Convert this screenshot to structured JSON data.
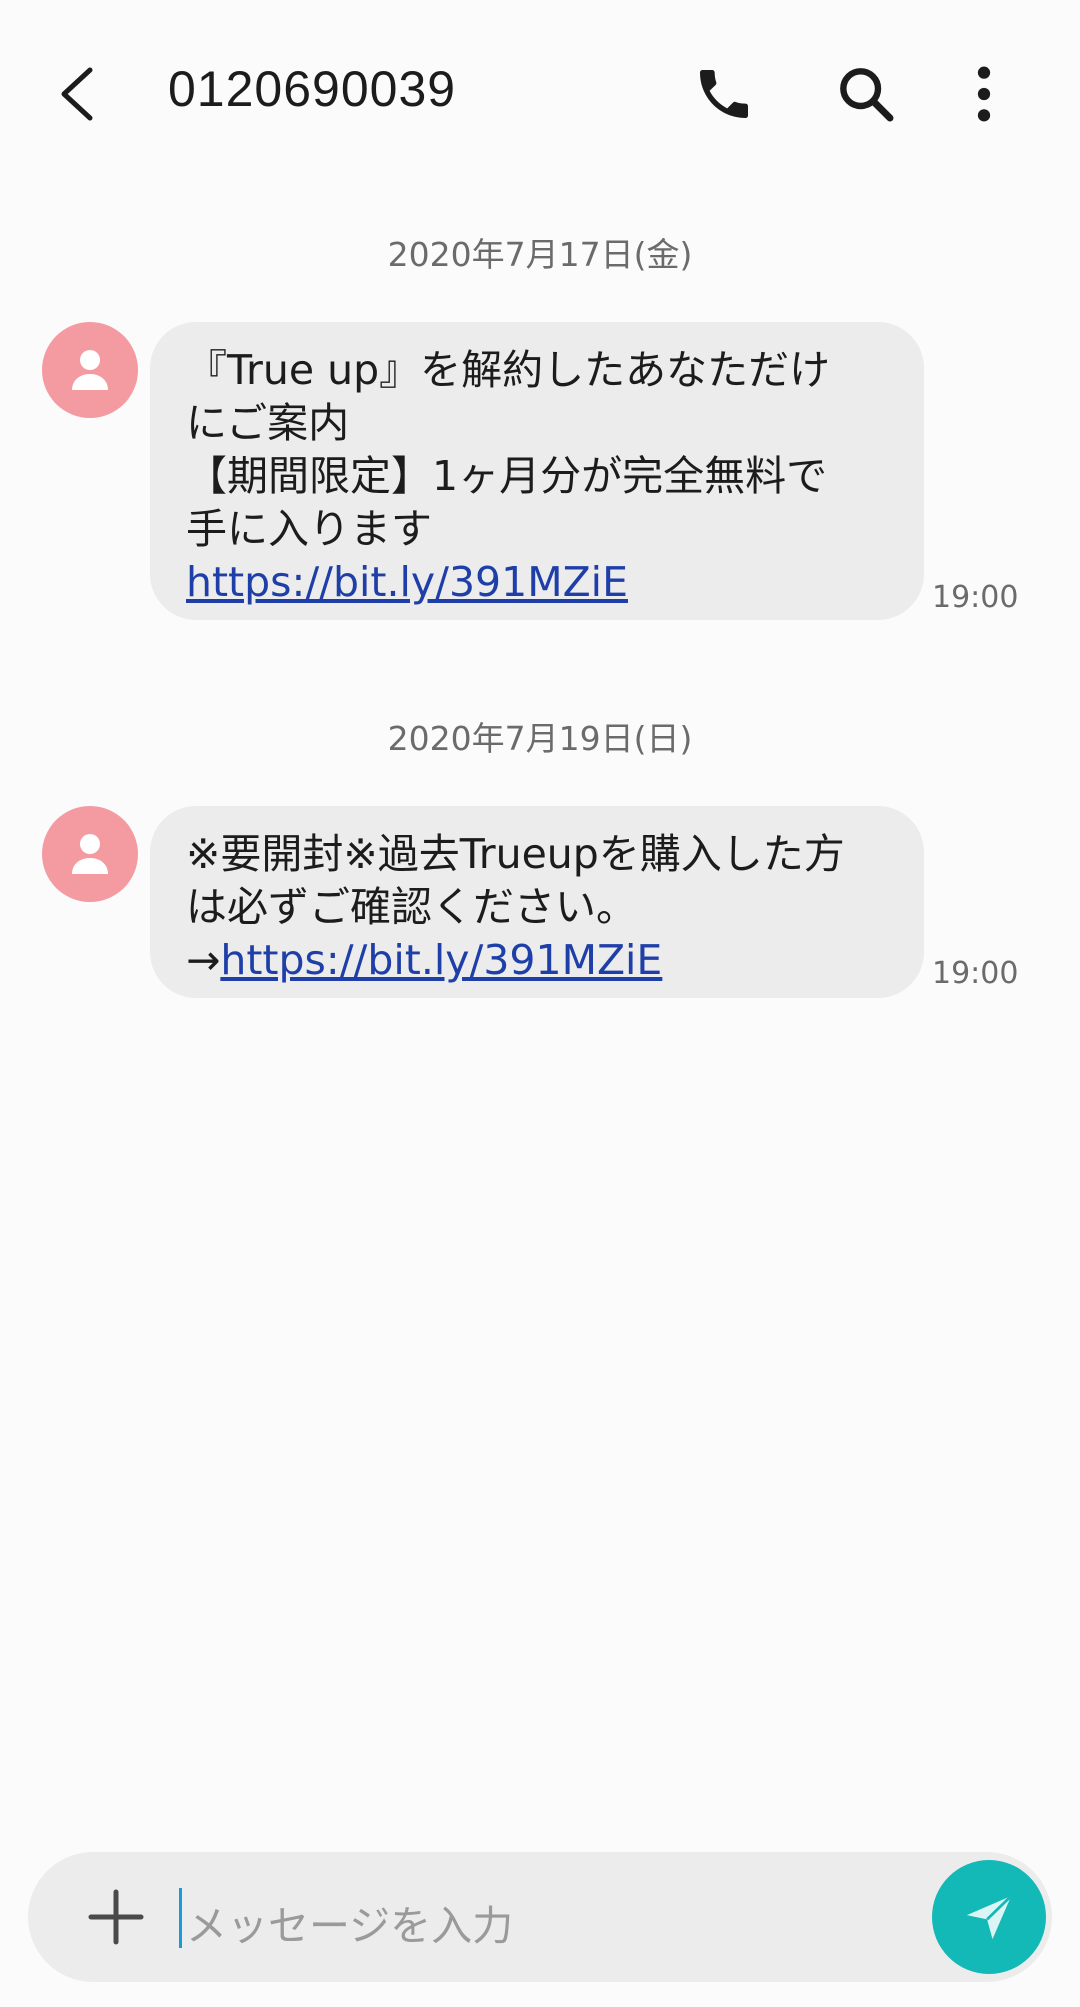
{
  "header": {
    "title": "0120690039",
    "back_icon": "back-arrow-icon",
    "call_icon": "phone-icon",
    "search_icon": "search-icon",
    "more_icon": "more-vertical-icon"
  },
  "conversation": [
    {
      "date": "2020年7月17日(金)",
      "message": {
        "lines": [
          "『True up』を解約したあなただけ",
          "にご案内",
          "【期間限定】1ヶ月分が完全無料で",
          "手に入ります"
        ],
        "prefix": "",
        "link": "https://bit.ly/391MZiE",
        "time": "19:00"
      }
    },
    {
      "date": "2020年7月19日(日)",
      "message": {
        "lines": [
          "※要開封※過去Trueupを購入した方",
          "は必ずご確認ください。"
        ],
        "prefix": "→",
        "link": "https://bit.ly/391MZiE",
        "time": "19:00"
      }
    }
  ],
  "composer": {
    "placeholder": "メッセージを入力",
    "attach_icon": "plus-icon",
    "send_icon": "send-icon"
  },
  "colors": {
    "avatar": "#f49aa1",
    "bubble": "#ececed",
    "link": "#1f3fa8",
    "send": "#13b9b6"
  }
}
